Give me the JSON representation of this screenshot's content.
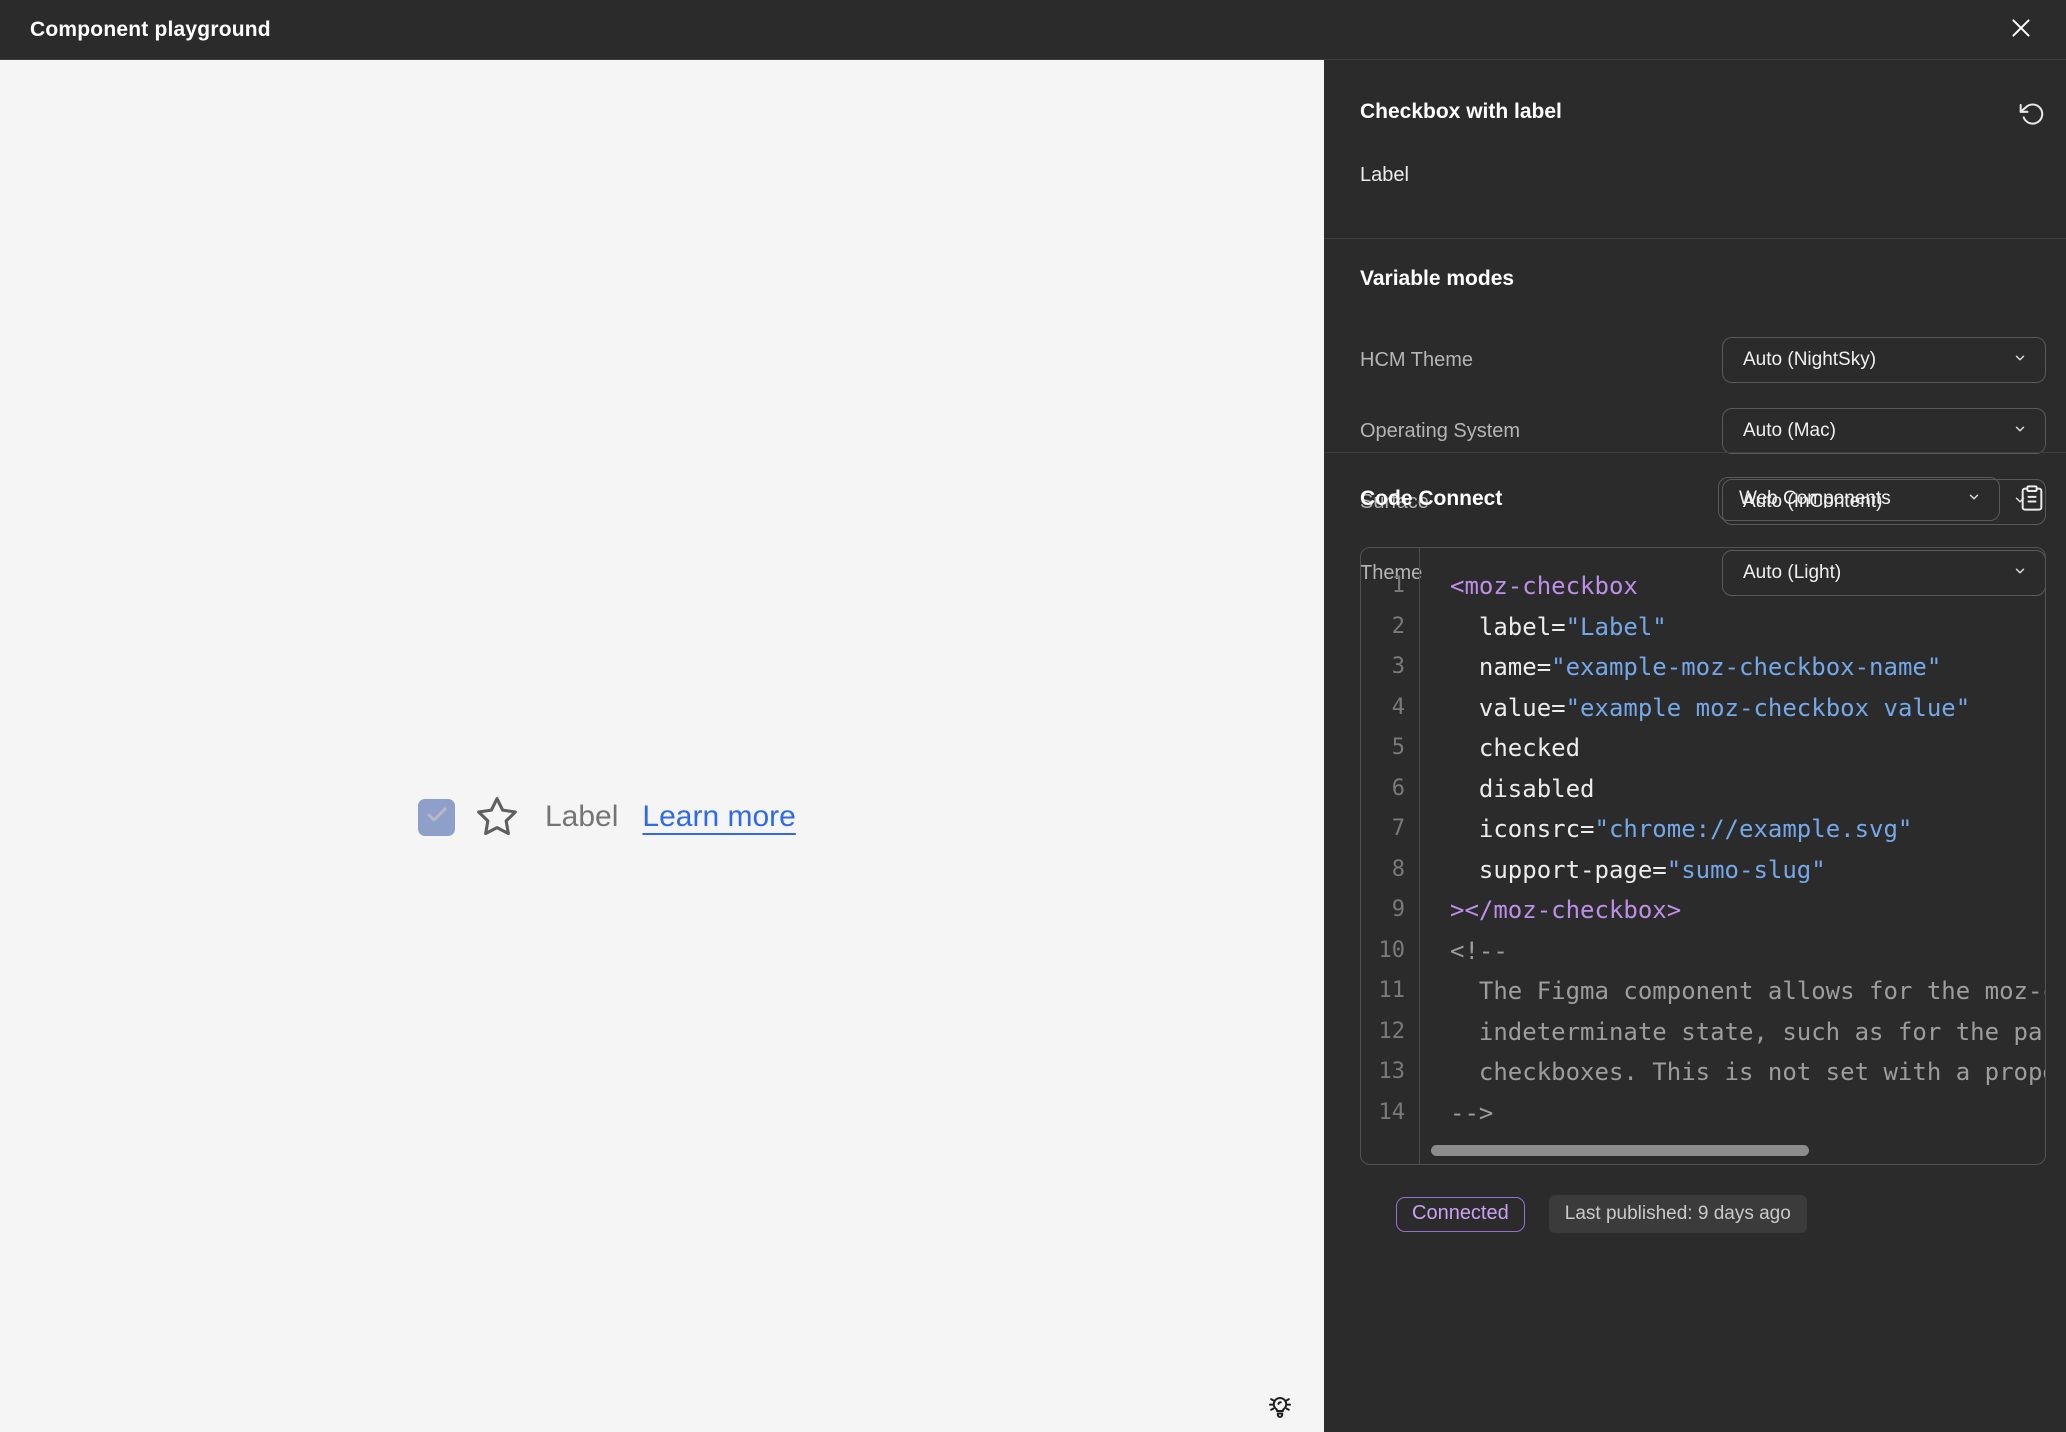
{
  "topbar": {
    "title": "Component playground"
  },
  "canvas": {
    "checkbox_checked": true,
    "label": "Label",
    "link_label": "Learn more"
  },
  "panel": {
    "component_title": "Checkbox with label",
    "component_label": "Label",
    "variable_modes": {
      "heading": "Variable modes",
      "modes": [
        {
          "label": "HCM Theme",
          "value": "Auto (NightSky)"
        },
        {
          "label": "Operating System",
          "value": "Auto (Mac)"
        },
        {
          "label": "Surface",
          "value": "Auto (InContent)"
        },
        {
          "label": "Theme",
          "value": "Auto (Light)"
        }
      ]
    },
    "code_connect": {
      "heading": "Code Connect",
      "language_selector_value": "Web Components",
      "status_badge": "Connected",
      "last_published": "Last published: 9 days ago"
    }
  },
  "code": {
    "lines": [
      {
        "n": 1,
        "tokens": [
          {
            "c": "tag",
            "t": "<moz-checkbox"
          }
        ]
      },
      {
        "n": 2,
        "tokens": [
          {
            "c": "attr",
            "t": "  label"
          },
          {
            "c": "punct",
            "t": "="
          },
          {
            "c": "string",
            "t": "\"Label\""
          }
        ]
      },
      {
        "n": 3,
        "tokens": [
          {
            "c": "attr",
            "t": "  name"
          },
          {
            "c": "punct",
            "t": "="
          },
          {
            "c": "string",
            "t": "\"example-moz-checkbox-name\""
          }
        ]
      },
      {
        "n": 4,
        "tokens": [
          {
            "c": "attr",
            "t": "  value"
          },
          {
            "c": "punct",
            "t": "="
          },
          {
            "c": "string",
            "t": "\"example moz-checkbox value\""
          }
        ]
      },
      {
        "n": 5,
        "tokens": [
          {
            "c": "attr",
            "t": "  checked"
          }
        ]
      },
      {
        "n": 6,
        "tokens": [
          {
            "c": "attr",
            "t": "  disabled"
          }
        ]
      },
      {
        "n": 7,
        "tokens": [
          {
            "c": "attr",
            "t": "  iconsrc"
          },
          {
            "c": "punct",
            "t": "="
          },
          {
            "c": "string",
            "t": "\"chrome://example.svg\""
          }
        ]
      },
      {
        "n": 8,
        "tokens": [
          {
            "c": "attr",
            "t": "  support-page"
          },
          {
            "c": "punct",
            "t": "="
          },
          {
            "c": "string",
            "t": "\"sumo-slug\""
          }
        ]
      },
      {
        "n": 9,
        "tokens": [
          {
            "c": "tag",
            "t": "></moz-checkbox>"
          }
        ]
      },
      {
        "n": 10,
        "tokens": [
          {
            "c": "comment",
            "t": "<!--"
          }
        ]
      },
      {
        "n": 11,
        "tokens": [
          {
            "c": "comment",
            "t": "  The Figma component allows for the moz-ch"
          }
        ]
      },
      {
        "n": 12,
        "tokens": [
          {
            "c": "comment",
            "t": "  indeterminate state, such as for the par"
          }
        ]
      },
      {
        "n": 13,
        "tokens": [
          {
            "c": "comment",
            "t": "  checkboxes. This is not set with a prope"
          }
        ]
      },
      {
        "n": 14,
        "tokens": [
          {
            "c": "comment",
            "t": "-->"
          }
        ]
      }
    ]
  },
  "icons": {
    "close": "close-icon",
    "reset": "reset-icon",
    "chevron": "chevron-down-icon",
    "clipboard": "clipboard-icon",
    "checkmark": "checkmark-icon",
    "star": "star-icon",
    "lightbulb": "lightbulb-icon"
  },
  "colors": {
    "topbar_bg": "#2B2B2B",
    "panel_bg": "#2B2B2B",
    "canvas_bg": "#F5F5F5",
    "checkbox_bg": "#8EA0C9",
    "link_blue": "#2E6BE8",
    "connected_purple": "#C9A1F5",
    "code_tag": "#BE8FE8",
    "code_string": "#74A8E8",
    "code_comment": "#9D9D9D"
  }
}
